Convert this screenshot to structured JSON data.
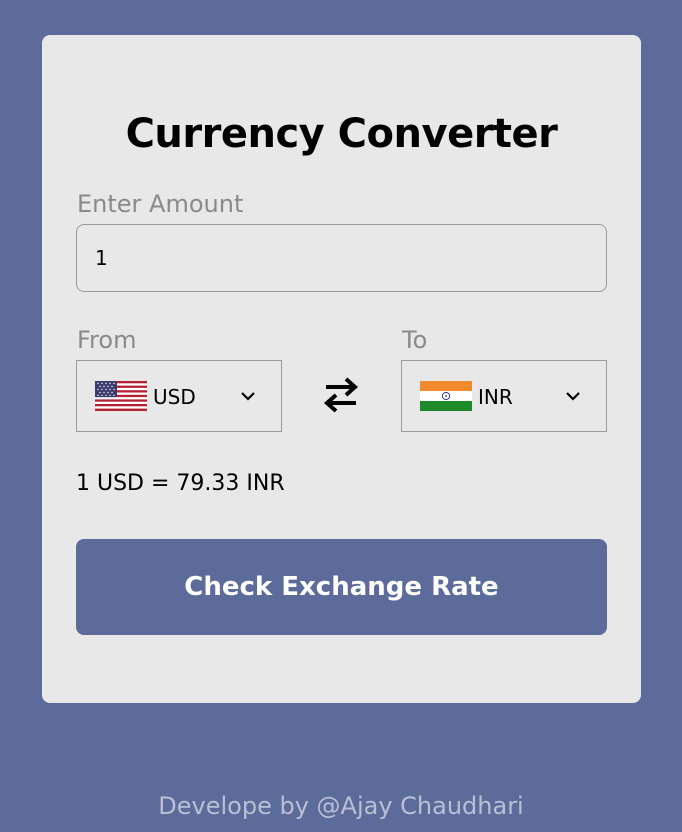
{
  "app": {
    "title": "Currency Converter",
    "footer": "Develope by @Ajay Chaudhari"
  },
  "amount": {
    "label": "Enter Amount",
    "value": "1"
  },
  "from": {
    "label": "From",
    "currency": "USD",
    "flag_icon": "us-flag-icon"
  },
  "to": {
    "label": "To",
    "currency": "INR",
    "flag_icon": "india-flag-icon"
  },
  "swap_icon": "swap-arrows-icon",
  "rate_text": "1 USD = 79.33 INR",
  "button": {
    "label": "Check Exchange Rate"
  },
  "colors": {
    "background": "#5d6b9a",
    "card": "#e8e8e8",
    "button": "#5d6b9a",
    "label": "#8a8a8a"
  }
}
